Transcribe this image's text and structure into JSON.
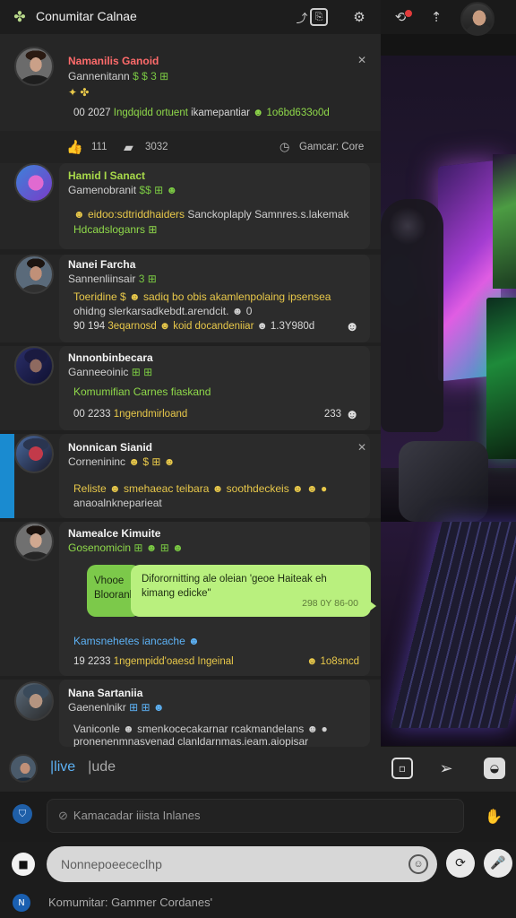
{
  "app": {
    "title": "Conumitar Calnae",
    "logo_icon": "✤",
    "icons": {
      "edit": "⎘",
      "settings": "⚙",
      "back": "⟲",
      "up": "⇡"
    }
  },
  "cards": [
    {
      "name": "Namanilis Ganoid",
      "sub": "Gannenitann",
      "sub_tags": "$ $ 3 ⊞",
      "line2": "✦ ✤",
      "meta_num": "00  2027",
      "meta_a": "Ingdqidd ortuent",
      "meta_b": "ikamepantiar",
      "meta_c": "☻ 1o6bd633o0d",
      "close": "✕"
    },
    {
      "name": "Hamid I Sanact",
      "sub": "Gamenobranit",
      "sub_tags": "$$ ⊞ ☻",
      "text_a": "☻ eidoo:sdtriddhaiders",
      "text_b": "Sanckoplaply Samnres.s.lakemak",
      "text_c": "Hdcadsloganrs ⊞"
    },
    {
      "name": "Nanei Farcha",
      "sub": "Sannenliinsair",
      "sub_tags": "3 ⊞",
      "text_a": "Toeridine $ ☻ sadiq bo obis akamlenpolaing ipsensea",
      "text_b": "ohidng slerkarsadkebdt.arendcit. ☻ 0",
      "meta_num": "90  194",
      "meta_a": "3eqarnosd",
      "meta_b": "☻ koid docandeniiar",
      "meta_c": "☻ 1.3Y980d",
      "right_icon": "☻"
    },
    {
      "name": "Nnnonbinbecara",
      "sub": "Ganneeoinic",
      "sub_tags": "⊞ ⊞",
      "text_a": "Komumifian Carnes fiaskand",
      "meta_num": "00  2233",
      "meta_a": "1ngendmirloand",
      "meta_right": "233",
      "right_icon": "☻"
    },
    {
      "name": "Nonnican Sianid",
      "sub": "Cornenininc",
      "sub_tags": "☻ $ ⊞ ☻",
      "text_a": "Reliste ☻ smehaeac teibara ☻ soothdeckeis ☻ ☻ ●",
      "text_b": "anaoalnkneparieat",
      "close": "✕"
    },
    {
      "name": "Namealce Kimuite",
      "sub": "Gosenomicin",
      "sub_tags": "⊞ ☻ ⊞ ☻",
      "bubble_a": "Vhooe",
      "bubble_b": "Blooranl",
      "bubble_main_1": "Diforornitting ale oleian 'geoe Haiteak eh",
      "bubble_main_2": "kimang edicke\"",
      "bubble_time": "298 0Y 86-00",
      "text_a": "Kamsnehetes iancache ☻",
      "meta_num": "19  2233",
      "meta_a": "1ngempidd'oaesd Ingeinal",
      "meta_right": "☻ 1o8sncd"
    },
    {
      "name": "Nana Sartaniia",
      "sub": "Gaenenlnikr",
      "sub_tags": "⊞ ⊞ ☻",
      "text_a": "Vaniconle ☻ smenkocecakarnar rcakmandelans ☻ ●",
      "text_b": "pronenenmnasvenad clanldarnmas.ieam.aiopisar"
    }
  ],
  "action_row": {
    "like": "111",
    "comments": "3032",
    "comment_label": "Gamcar: Core"
  },
  "live_bar": {
    "tab_live": "|live",
    "tab_other": "|ude"
  },
  "info": {
    "placeholder": "Kamacadar iiista Inlanes",
    "icon": "⊘"
  },
  "composer": {
    "placeholder": "Nonnepoeececlhp"
  },
  "footer": {
    "text": "Komumitar: Gammer Cordanes'"
  }
}
